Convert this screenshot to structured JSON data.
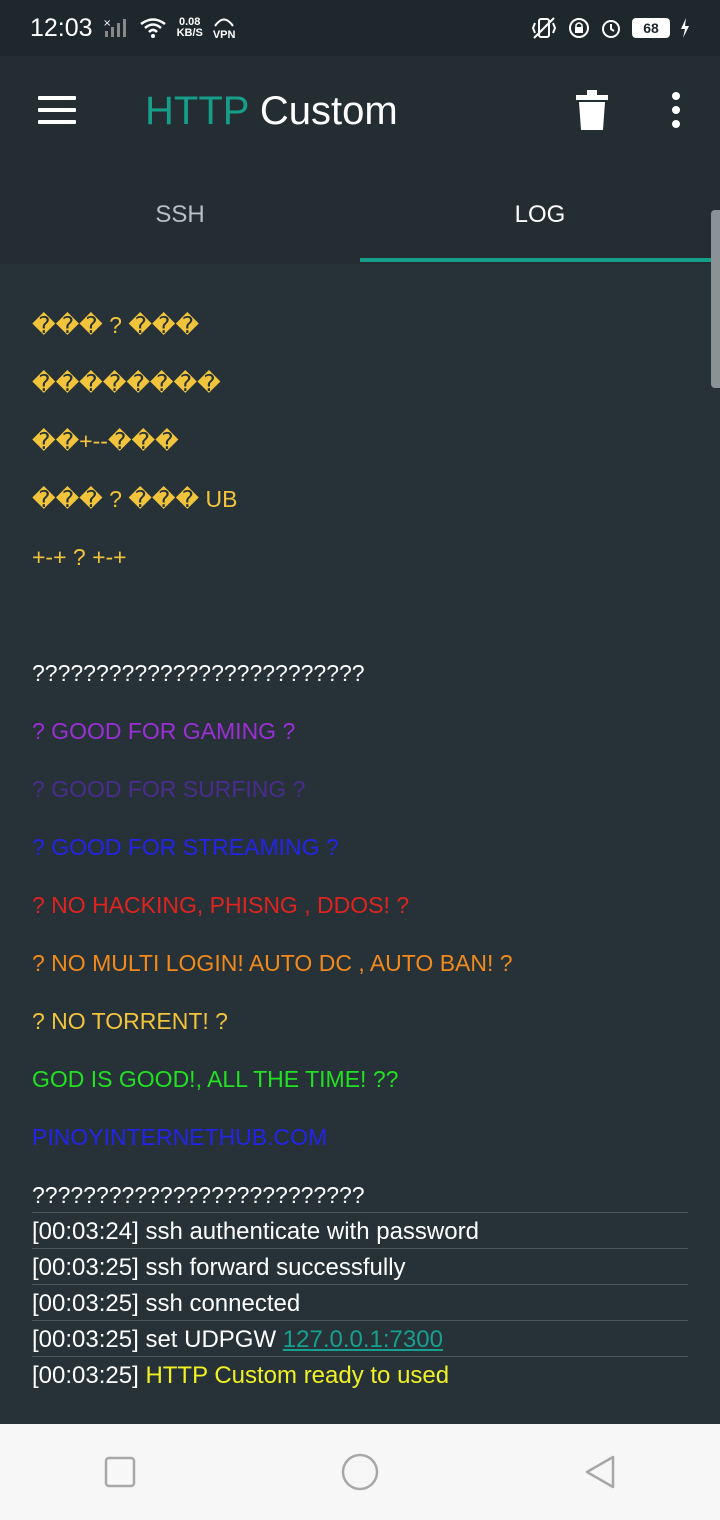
{
  "status_bar": {
    "time": "12:03",
    "speed_value": "0.08",
    "speed_unit": "KB/S",
    "vpn": "VPN",
    "battery": "68"
  },
  "appbar": {
    "title_part1": "HTTP",
    "title_part2": "Custom"
  },
  "tabs": [
    {
      "label": "SSH",
      "active": false
    },
    {
      "label": "LOG",
      "active": true
    }
  ],
  "log_lines": [
    "��� ? ���",
    "��������",
    "��+--���",
    "��� ? ��� UB",
    "+-+ ? +-+",
    "",
    "??????????????????????????",
    "? GOOD FOR GAMING ?",
    "? GOOD FOR SURFING ?",
    "? GOOD FOR STREAMING ?",
    "? NO HACKING, PHISNG , DDOS! ?",
    "? NO MULTI LOGIN! AUTO DC , AUTO BAN! ?",
    "? NO TORRENT! ?",
    "GOD IS GOOD!, ALL THE TIME! ??",
    "PINOYINTERNETHUB.COM",
    "??????????????????????????"
  ],
  "events": [
    {
      "time": "[00:03:24]",
      "text": "ssh authenticate with password"
    },
    {
      "time": "[00:03:25]",
      "text": "ssh forward successfully"
    },
    {
      "time": "[00:03:25]",
      "text": "ssh connected"
    },
    {
      "time": "[00:03:25]",
      "text": "set UDPGW",
      "link": "127.0.0.1:7300"
    },
    {
      "time": "[00:03:25]",
      "text": "",
      "highlight": "HTTP Custom ready to used"
    }
  ],
  "colors": {
    "accent": "#159f8a",
    "background": "#263238",
    "appbar": "#232d32"
  }
}
